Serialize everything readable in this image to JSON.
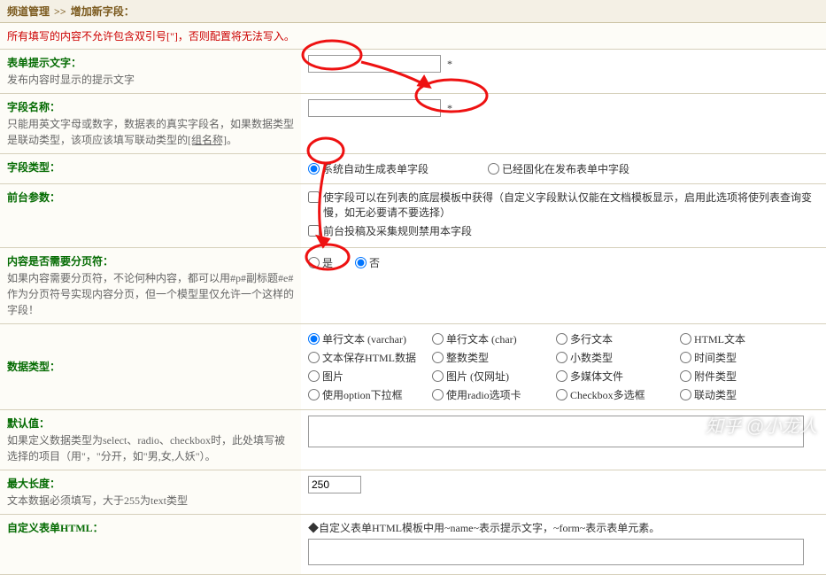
{
  "breadcrumb": {
    "section": "频道管理",
    "page": "增加新字段："
  },
  "warning": "所有填写的内容不允许包含双引号[\"]，否则配置将无法写入。",
  "rows": {
    "prompt": {
      "title": "表单提示文字：",
      "desc": "发布内容时显示的提示文字"
    },
    "fieldname": {
      "title": "字段名称：",
      "desc": "只能用英文字母或数字，数据表的真实字段名，如果数据类型是联动类型，该项应该填写联动类型的[组名称]。"
    },
    "fieldtype": {
      "title": "字段类型：",
      "opt1": "系统自动生成表单字段",
      "opt2": "已经固化在发布表单中字段"
    },
    "frontparam": {
      "title": "前台参数：",
      "chk1": "使字段可以在列表的底层模板中获得（自定义字段默认仅能在文档模板显示，启用此选项将使列表查询变慢，如无必要请不要选择）",
      "chk2": "前台投稿及采集规则禁用本字段"
    },
    "paging": {
      "title": "内容是否需要分页符：",
      "desc": "如果内容需要分页符，不论何种内容，都可以用#p#副标题#e#作为分页符号实现内容分页，但一个模型里仅允许一个这样的字段！",
      "yes": "是",
      "no": "否"
    },
    "datatype": {
      "title": "数据类型："
    },
    "default": {
      "title": "默认值：",
      "desc": "如果定义数据类型为select、radio、checkbox时，此处填写被选择的项目（用\"，\"分开，如\"男,女,人妖\"）。"
    },
    "maxlen": {
      "title": "最大长度：",
      "desc": "文本数据必须填写，大于255为text类型",
      "value": "250"
    },
    "customhtml": {
      "title": "自定义表单HTML：",
      "desc": "◆自定义表单HTML模板中用~name~表示提示文字，~form~表示表单元素。"
    }
  },
  "datatypes": [
    [
      "单行文本 (varchar)",
      "单行文本 (char)",
      "多行文本",
      "HTML文本"
    ],
    [
      "文本保存HTML数据",
      "整数类型",
      "小数类型",
      "时间类型"
    ],
    [
      "图片",
      "图片 (仅网址)",
      "多媒体文件",
      "附件类型"
    ],
    [
      "使用option下拉框",
      "使用radio选项卡",
      "Checkbox多选框",
      "联动类型"
    ]
  ],
  "watermark": "知乎 @小龙人"
}
